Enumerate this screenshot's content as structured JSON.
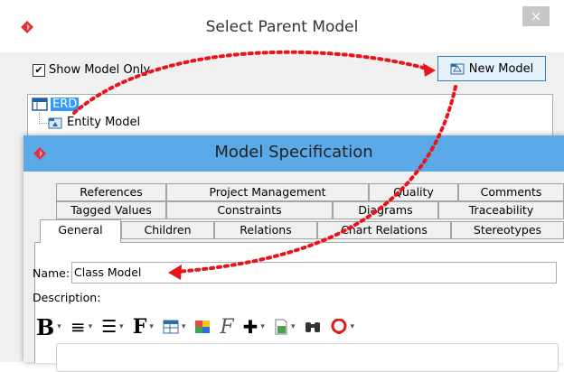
{
  "parent_dialog": {
    "title": "Select Parent Model",
    "close_glyph": "×",
    "show_model_only_label": "Show Model Only",
    "show_model_only_checked": true,
    "check_glyph": "✔",
    "new_model_label": "New Model",
    "tree": [
      {
        "label": "ERD",
        "selected": true,
        "icon": "erd-diagram-icon"
      },
      {
        "label": "Entity Model",
        "selected": false,
        "icon": "model-icon"
      }
    ]
  },
  "spec_dialog": {
    "title": "Model Specification",
    "tabs_row1": [
      "References",
      "Project Management",
      "Quality",
      "Comments"
    ],
    "tabs_row2": [
      "Tagged Values",
      "Constraints",
      "Diagrams",
      "Traceability"
    ],
    "tabs_row3": [
      "General",
      "Children",
      "Relations",
      "Chart Relations",
      "Stereotypes"
    ],
    "active_tab": "General",
    "name_label": "Name:",
    "name_value": "Class Model",
    "description_label": "Description:",
    "toolbar": [
      {
        "icon": "font-style-icon",
        "glyph": "B"
      },
      {
        "icon": "align-icon",
        "glyph": "≡"
      },
      {
        "icon": "list-icon",
        "glyph": "☰"
      },
      {
        "icon": "font-icon",
        "glyph": "F"
      },
      {
        "icon": "table-icon",
        "glyph": ""
      },
      {
        "icon": "color-icon",
        "glyph": ""
      },
      {
        "icon": "format-icon",
        "glyph": "F"
      },
      {
        "icon": "insert-icon",
        "glyph": "✚"
      },
      {
        "icon": "document-icon",
        "glyph": ""
      },
      {
        "icon": "find-icon",
        "glyph": "🔭"
      },
      {
        "icon": "spell-check-icon",
        "glyph": "O"
      }
    ]
  },
  "colors": {
    "accent_title": "#5ba9e6",
    "selection": "#3399ff",
    "arrow": "#e8141a",
    "logo": "#d9333f"
  }
}
